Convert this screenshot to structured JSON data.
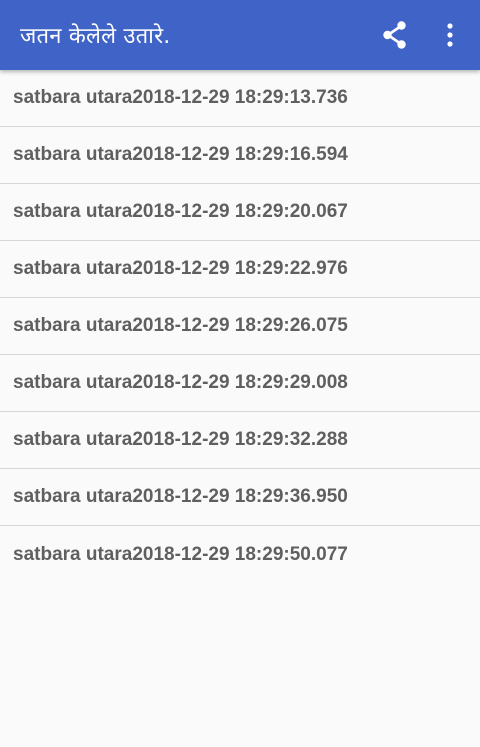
{
  "colors": {
    "app_bar": "#3f63c6",
    "background": "#fafafa",
    "item_text": "#5f5f5f",
    "divider": "#d7d7d7"
  },
  "app_bar": {
    "title": "जतन केलेले उतारे.",
    "actions": [
      {
        "icon": "share-icon"
      },
      {
        "icon": "more-vert-icon"
      }
    ]
  },
  "saved_list": {
    "items": [
      {
        "label": "satbara utara2018-12-29 18:29:13.736"
      },
      {
        "label": "satbara utara2018-12-29 18:29:16.594"
      },
      {
        "label": "satbara utara2018-12-29 18:29:20.067"
      },
      {
        "label": "satbara utara2018-12-29 18:29:22.976"
      },
      {
        "label": "satbara utara2018-12-29 18:29:26.075"
      },
      {
        "label": "satbara utara2018-12-29 18:29:29.008"
      },
      {
        "label": "satbara utara2018-12-29 18:29:32.288"
      },
      {
        "label": "satbara utara2018-12-29 18:29:36.950"
      },
      {
        "label": "satbara utara2018-12-29 18:29:50.077"
      }
    ]
  }
}
